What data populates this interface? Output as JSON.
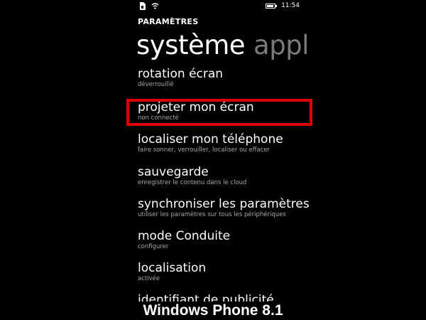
{
  "status_bar": {
    "time": "11:54",
    "icons": [
      "sim-icon",
      "wifi-icon",
      "battery-icon"
    ]
  },
  "header": {
    "hub_title": "PARAMÈTRES"
  },
  "pivot": {
    "active": "système",
    "next": "applications",
    "next_visible": "applic"
  },
  "items": [
    {
      "title": "rotation écran",
      "subtitle": "déverrouillé"
    },
    {
      "title": "projeter mon écran",
      "subtitle": "non connecté"
    },
    {
      "title": "localiser mon téléphone",
      "subtitle": "faire sonner, verrouiller, localiser ou effacer"
    },
    {
      "title": "sauvegarde",
      "subtitle": "enregistrer le contenu dans le cloud"
    },
    {
      "title": "synchroniser les paramètres",
      "subtitle": "utiliser les paramètres sur tous les périphériques"
    },
    {
      "title": "mode Conduite",
      "subtitle": "configurer"
    },
    {
      "title": "localisation",
      "subtitle": "activée"
    },
    {
      "title": "identifiant de publicité",
      "subtitle": ""
    }
  ],
  "highlight": {
    "target": "projeter mon écran",
    "color": "#e00000"
  },
  "caption": "Windows Phone 8.1"
}
